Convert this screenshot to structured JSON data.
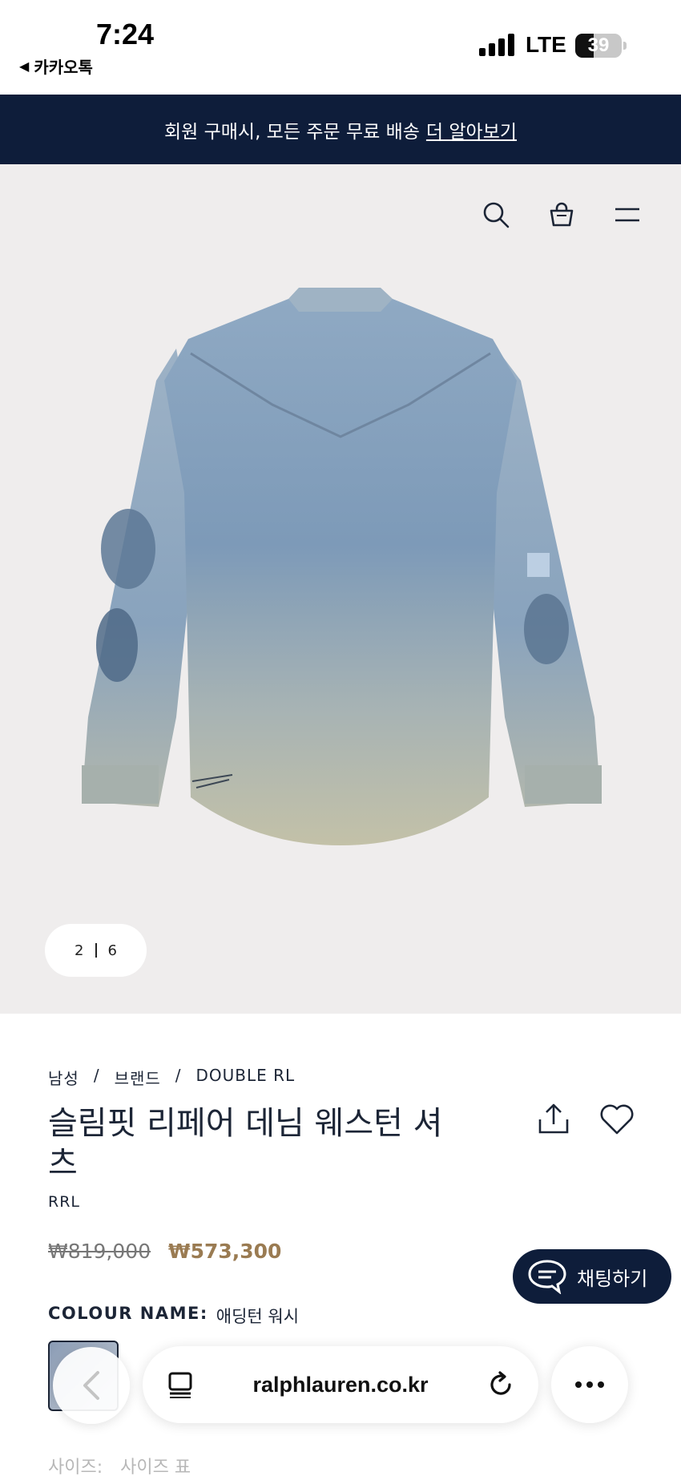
{
  "status_bar": {
    "time": "7:24",
    "back_app_label": "카카오톡",
    "network": "LTE",
    "battery_percent": "39",
    "battery_level": 0.39
  },
  "promo": {
    "text": "회원 구매시, 모든 주문 무료 배송",
    "link": "더 알아보기"
  },
  "hero": {
    "icons": [
      "search-icon",
      "bag-icon",
      "menu-icon"
    ],
    "pager_current": "2",
    "pager_total": "6"
  },
  "product": {
    "breadcrumb": [
      "남성",
      "/",
      "브랜드",
      "/",
      "DOUBLE RL"
    ],
    "title": "슬림핏 리페어 데님 웨스턴 셔츠",
    "brand": "RRL",
    "price_original": "₩819,000",
    "price_sale": "₩573,300",
    "colour_label": "COLOUR NAME:",
    "colour_value": "애딩턴 워시",
    "size_label": "사이즈:",
    "size_chart_label": "사이즈 표"
  },
  "chat": {
    "label": "채팅하기"
  },
  "browser": {
    "url": "ralphlauren.co.kr"
  },
  "colors": {
    "navy": "#0e1d3a",
    "sale_price": "#9a7b52",
    "hero_bg": "#efeded"
  }
}
